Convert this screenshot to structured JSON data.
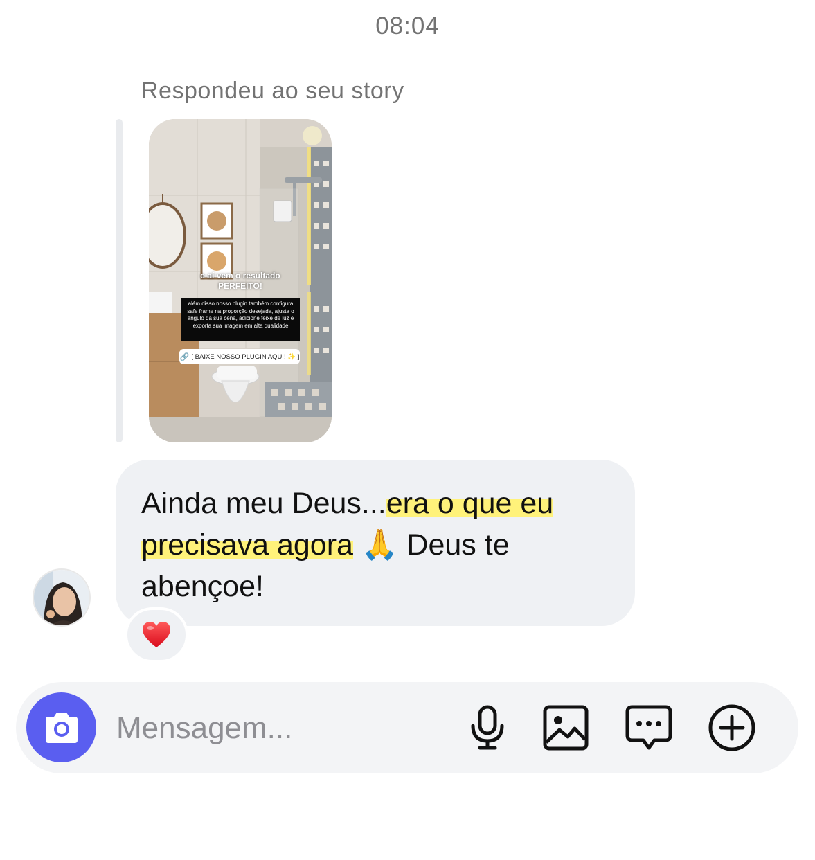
{
  "thread": {
    "timestamp": "08:04",
    "reply_label": "Respondeu ao seu story"
  },
  "story": {
    "title": "e aí vem o resultado\nPERFEITO!",
    "body": "além disso nosso plugin também configura safe frame na proporção desejada, ajusta o ângulo da sua cena, adicione feixe de luz e exporta sua imagem em alta qualidade",
    "link_text": "[ BAIXE NOSSO PLUGIN AQUI! ✨ ]"
  },
  "message": {
    "part1": "Ainda meu Deus...",
    "highlight": "era o que eu precisava agora",
    "emoji": "🙏",
    "part2": "Deus te abençoe!",
    "reaction": "❤️",
    "reaction_icon": "heart-icon"
  },
  "composer": {
    "placeholder": "Mensagem...",
    "icons": [
      "camera-icon",
      "microphone-icon",
      "gallery-icon",
      "chat-icon",
      "plus-icon"
    ],
    "camera_color": "#5a5ef0"
  }
}
